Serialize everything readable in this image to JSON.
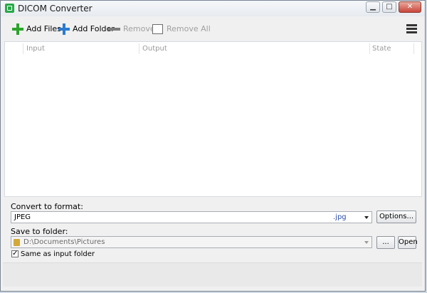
{
  "window": {
    "title": "DICOM Converter",
    "minimize_glyph": "▁",
    "maximize_glyph": "□",
    "close_glyph": "✕"
  },
  "toolbar": {
    "add_files": "Add Files",
    "add_folder": "Add Folder",
    "remove": "Remove",
    "remove_all": "Remove All",
    "add_files_color": "#2aa52a",
    "add_folder_color": "#2b7bd1"
  },
  "table": {
    "columns": [
      "Input",
      "Output",
      "State"
    ]
  },
  "convert": {
    "label": "Convert to format:",
    "format_value": "JPEG",
    "extension": ".jpg",
    "options_button": "Options..."
  },
  "save": {
    "label": "Save to folder:",
    "folder_value": "D:\\Documents\\Pictures",
    "browse_button": "...",
    "open_button": "Open",
    "same_as_input_label": "Same as input folder",
    "same_as_input_checked": "✓"
  }
}
